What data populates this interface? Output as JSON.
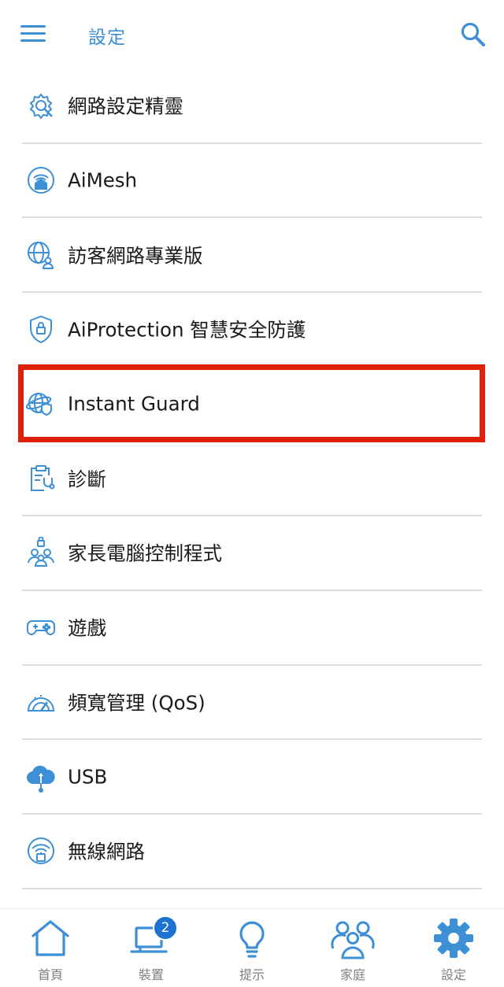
{
  "header": {
    "title": "設定"
  },
  "menu_items": [
    {
      "label": "網路設定精靈",
      "icon": "wizard-gear-icon"
    },
    {
      "label": "AiMesh",
      "icon": "aimesh-home-wifi-icon"
    },
    {
      "label": "訪客網路專業版",
      "icon": "guest-network-globe-icon"
    },
    {
      "label": "AiProtection 智慧安全防護",
      "icon": "shield-lock-icon"
    },
    {
      "label": "Instant Guard",
      "icon": "globe-shield-icon"
    },
    {
      "label": "診斷",
      "icon": "clipboard-stethoscope-icon"
    },
    {
      "label": "家長電腦控制程式",
      "icon": "family-lock-icon"
    },
    {
      "label": "遊戲",
      "icon": "gamepad-icon"
    },
    {
      "label": "頻寬管理 (QoS)",
      "icon": "speedometer-icon"
    },
    {
      "label": "USB",
      "icon": "usb-cloud-icon"
    },
    {
      "label": "無線網路",
      "icon": "wireless-router-icon"
    }
  ],
  "highlighted_item": "Instant Guard",
  "tabs": [
    {
      "label": "首頁",
      "icon": "home-icon"
    },
    {
      "label": "裝置",
      "icon": "devices-icon",
      "badge": "2"
    },
    {
      "label": "提示",
      "icon": "lightbulb-icon"
    },
    {
      "label": "家庭",
      "icon": "family-icon"
    },
    {
      "label": "設定",
      "icon": "gear-icon",
      "active": true
    }
  ],
  "colors": {
    "accent": "#3d8fd6",
    "highlight_border": "#e0210a",
    "badge": "#1e72d2",
    "tab_label": "#7f7f7f",
    "divider": "#dcdcdc"
  }
}
